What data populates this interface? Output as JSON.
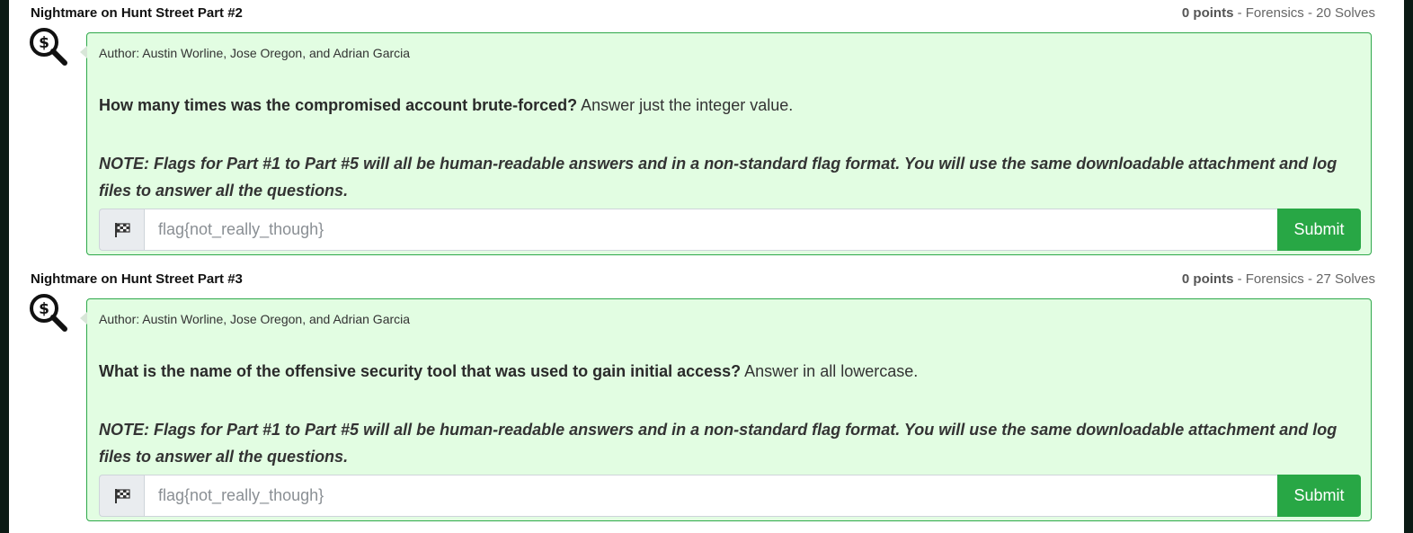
{
  "challenges": [
    {
      "title": "Nightmare on Hunt Street Part #2",
      "points": "0 points",
      "meta": " - Forensics - 20 Solves",
      "author": "Author: Austin Worline, Jose Oregon, and Adrian Garcia",
      "question_bold": "How many times was the compromised account brute-forced?",
      "question_rest": " Answer just the integer value.",
      "note": "NOTE: Flags for Part #1 to Part #5 will all be human-readable answers and in a non-standard flag format. You will use the same downloadable attachment and log files to answer all the questions.",
      "flag_placeholder": "flag{not_really_though}",
      "submit_label": "Submit"
    },
    {
      "title": "Nightmare on Hunt Street Part #3",
      "points": "0 points",
      "meta": " - Forensics - 27 Solves",
      "author": "Author: Austin Worline, Jose Oregon, and Adrian Garcia",
      "question_bold": "What is the name of the offensive security tool that was used to gain initial access?",
      "question_rest": " Answer in all lowercase.",
      "note": "NOTE: Flags for Part #1 to Part #5 will all be human-readable answers and in a non-standard flag format. You will use the same downloadable attachment and log files to answer all the questions.",
      "flag_placeholder": "flag{not_really_though}",
      "submit_label": "Submit"
    }
  ],
  "icons": {
    "challenge_icon": "magnifier-dollar-icon",
    "flag_icon": "checkered-flag-icon"
  },
  "colors": {
    "card_background": "#e2fde2",
    "card_border": "#2ea84a",
    "submit_background": "#28a745"
  }
}
